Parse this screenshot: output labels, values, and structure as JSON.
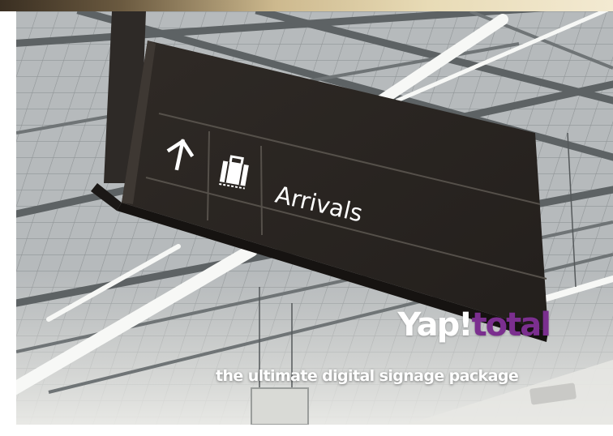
{
  "sign": {
    "arrivals_label": "Arrivals",
    "arrow_icon": "arrow-up-icon",
    "luggage_icon": "luggage-icon"
  },
  "brand": {
    "name_white": "Yap!",
    "name_accent": "total",
    "tagline": "the ultimate digital signage package",
    "accent_color": "#7b2f8f"
  }
}
